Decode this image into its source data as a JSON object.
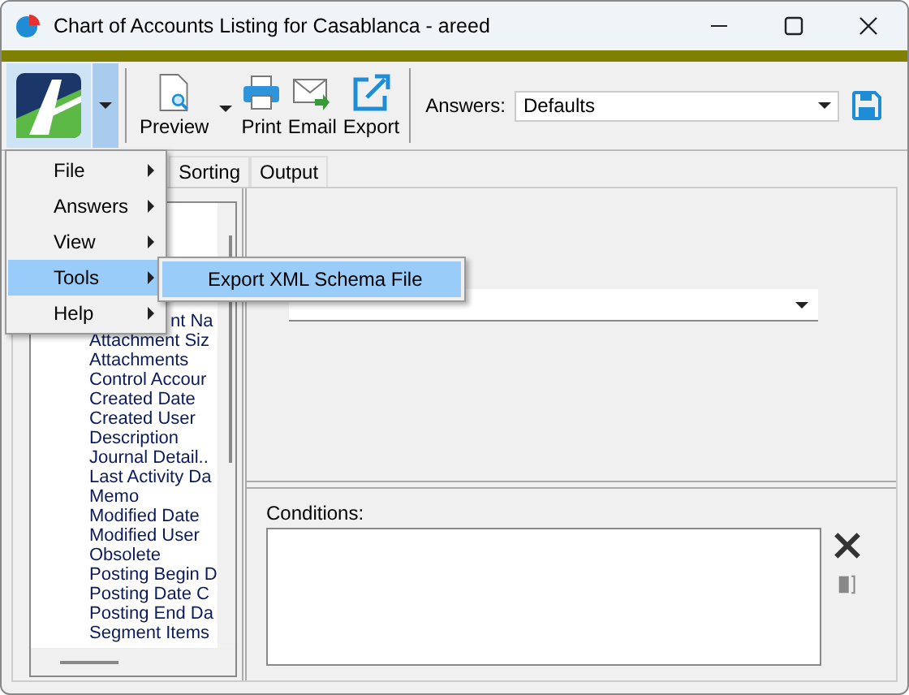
{
  "window": {
    "title": "Chart of Accounts Listing for Casablanca - areed"
  },
  "toolbar": {
    "buttons": [
      {
        "kind": "preview",
        "label": "Preview",
        "has_dropdown": true
      },
      {
        "kind": "print",
        "label": "Print",
        "has_dropdown": false
      },
      {
        "kind": "email",
        "label": "Email",
        "has_dropdown": false
      },
      {
        "kind": "export",
        "label": "Export",
        "has_dropdown": false
      }
    ],
    "answers": {
      "label": "Answers:",
      "value": "Defaults"
    }
  },
  "tabs": [
    {
      "label": "Sorting",
      "selected": false
    },
    {
      "label": "Output",
      "selected": false
    }
  ],
  "field_list": {
    "partial_item": "nt Na",
    "items": [
      {
        "label": "Attachment Siz"
      },
      {
        "label": "Attachments"
      },
      {
        "label": "Control Accour"
      },
      {
        "label": "Created Date"
      },
      {
        "label": "Created User"
      },
      {
        "label": "Description"
      },
      {
        "label": "Journal Detail.."
      },
      {
        "label": "Last Activity Da"
      },
      {
        "label": "Memo"
      },
      {
        "label": "Modified Date"
      },
      {
        "label": "Modified User"
      },
      {
        "label": "Obsolete"
      },
      {
        "label": "Posting Begin D"
      },
      {
        "label": "Posting Date C"
      },
      {
        "label": "Posting End Da"
      },
      {
        "label": "Segment Items"
      }
    ]
  },
  "conditions": {
    "label": "Conditions:"
  },
  "menu": {
    "items": [
      {
        "label": "File",
        "selected": false
      },
      {
        "label": "Answers",
        "selected": false
      },
      {
        "label": "View",
        "selected": false
      },
      {
        "label": "Tools",
        "selected": true,
        "submenu": [
          {
            "label": "Export XML Schema File",
            "selected": true
          }
        ]
      },
      {
        "label": "Help",
        "selected": false
      }
    ]
  }
}
